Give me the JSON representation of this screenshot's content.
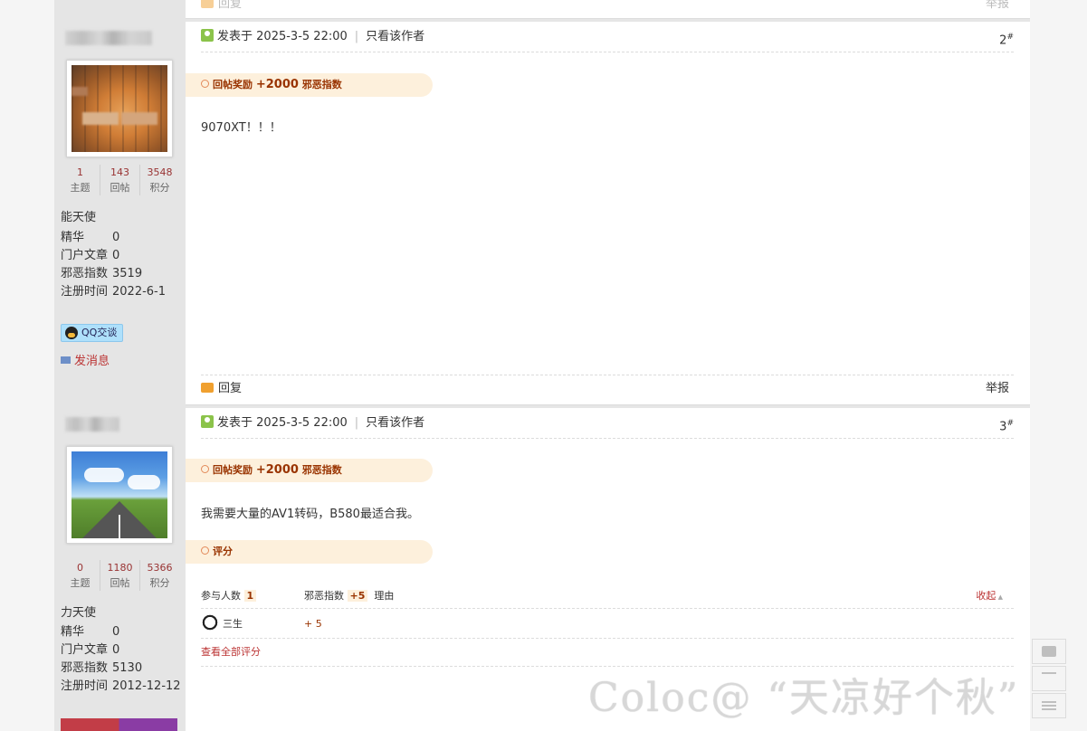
{
  "prev_footer": {
    "reply_label": "回复",
    "report_label": "举报"
  },
  "posts": [
    {
      "floor": "2",
      "floor_mark": "#",
      "header": {
        "posted_label": "发表于",
        "datetime": "2025-3-5 22:00",
        "only_author": "只看该作者"
      },
      "reward": {
        "label": "回帖奖励",
        "amount": "+2000",
        "unit": "邪恶指数"
      },
      "content": "9070XT！！！",
      "author": {
        "stats": [
          {
            "num": "1",
            "label": "主题"
          },
          {
            "num": "143",
            "label": "回帖"
          },
          {
            "num": "3548",
            "label": "积分"
          }
        ],
        "rank": "能天使",
        "info": [
          {
            "k": "精华",
            "v": "0"
          },
          {
            "k": "门户文章",
            "v": "0"
          },
          {
            "k": "邪恶指数",
            "v": "3519"
          },
          {
            "k": "注册时间",
            "v": "2022-6-1"
          }
        ],
        "qq_label": "QQ交谈",
        "msg_label": "发消息"
      },
      "footer": {
        "reply_label": "回复",
        "report_label": "举报"
      }
    },
    {
      "floor": "3",
      "floor_mark": "#",
      "header": {
        "posted_label": "发表于",
        "datetime": "2025-3-5 22:00",
        "only_author": "只看该作者"
      },
      "reward": {
        "label": "回帖奖励",
        "amount": "+2000",
        "unit": "邪恶指数"
      },
      "content": "我需要大量的AV1转码，B580最适合我。",
      "rating": {
        "title": "评分",
        "participants_label": "参与人数",
        "participants_count": "1",
        "score_label": "邪恶指数",
        "score_total": "+5",
        "reason_label": "理由",
        "collapse_label": "收起",
        "rows": [
          {
            "user": "三生",
            "points": "+ 5"
          }
        ],
        "view_all_label": "查看全部评分"
      },
      "author": {
        "stats": [
          {
            "num": "0",
            "label": "主题"
          },
          {
            "num": "1180",
            "label": "回帖"
          },
          {
            "num": "5366",
            "label": "积分"
          }
        ],
        "rank": "力天使",
        "info": [
          {
            "k": "精华",
            "v": "0"
          },
          {
            "k": "门户文章",
            "v": "0"
          },
          {
            "k": "邪恶指数",
            "v": "5130"
          },
          {
            "k": "注册时间",
            "v": "2012-12-12"
          }
        ]
      }
    }
  ],
  "watermark": "Coloc@ “天凉好个秋”",
  "side_tools": [
    "comment-icon",
    "back-to-top-icon",
    "list-icon"
  ]
}
